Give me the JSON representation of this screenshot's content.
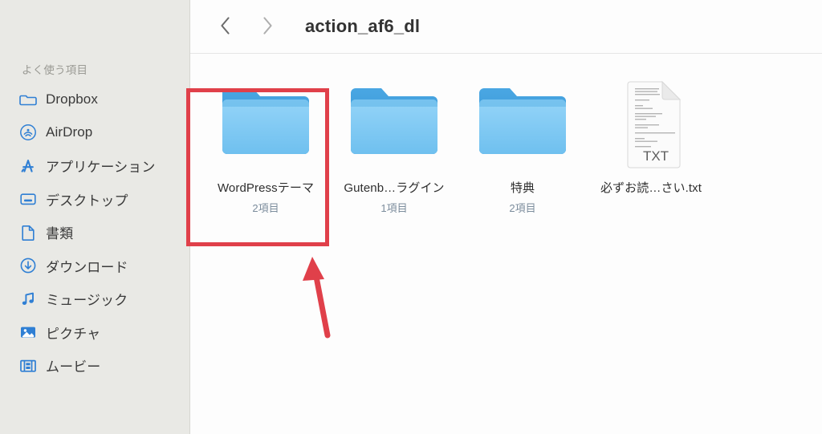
{
  "window": {
    "title": "action_af6_dl",
    "nav_back_icon": "chevron-left-icon",
    "nav_forward_icon": "chevron-right-icon"
  },
  "sidebar": {
    "section_title": "よく使う項目",
    "items": [
      {
        "label": "Dropbox",
        "icon": "folder-icon"
      },
      {
        "label": "AirDrop",
        "icon": "airdrop-icon"
      },
      {
        "label": "アプリケーション",
        "icon": "applications-icon"
      },
      {
        "label": "デスクトップ",
        "icon": "desktop-icon"
      },
      {
        "label": "書類",
        "icon": "document-icon"
      },
      {
        "label": "ダウンロード",
        "icon": "downloads-icon"
      },
      {
        "label": "ミュージック",
        "icon": "music-note-icon"
      },
      {
        "label": "ピクチャ",
        "icon": "picture-icon"
      },
      {
        "label": "ムービー",
        "icon": "movie-film-icon"
      }
    ]
  },
  "main": {
    "items": [
      {
        "name": "WordPressテーマ",
        "count": "2項目",
        "kind": "folder",
        "selected": true
      },
      {
        "name": "Gutenb…ラグイン",
        "count": "1項目",
        "kind": "folder",
        "selected": false
      },
      {
        "name": "特典",
        "count": "2項目",
        "kind": "folder",
        "selected": false
      },
      {
        "name": "必ずお読…さい.txt",
        "count": "",
        "kind": "text-file",
        "badge": "TXT",
        "selected": false
      }
    ]
  },
  "annotations": {
    "selection_box_color": "#e0404a",
    "arrow_color": "#e0404a",
    "arrow_target": "WordPressテーマ"
  },
  "colors": {
    "sidebar_background": "#e9e9e5",
    "main_background": "#fdfdfd",
    "folder_front": "#7ec9f5",
    "folder_back": "#3b9bdb",
    "sidebar_icon": "#2f7fd4",
    "item_count_text": "#7b8c9c"
  }
}
